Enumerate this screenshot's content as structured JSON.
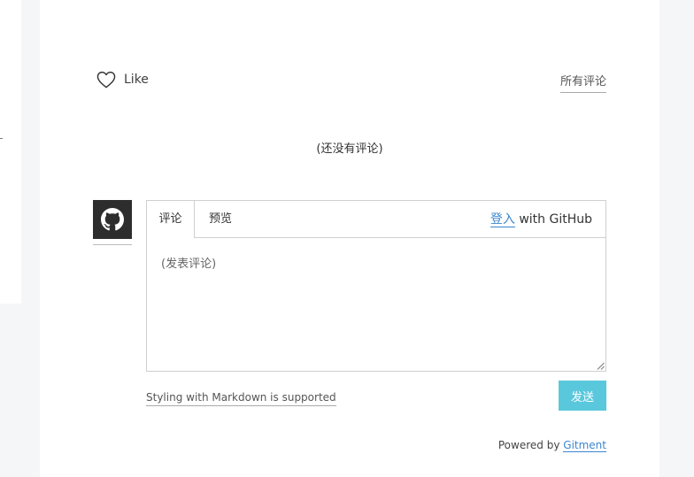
{
  "like": {
    "label": "Like",
    "icon": "heart-outline-icon"
  },
  "header": {
    "all_comments": "所有评论"
  },
  "comments": {
    "empty_text": "(还没有评论)"
  },
  "avatar": {
    "icon": "github-icon"
  },
  "editor": {
    "tabs": [
      {
        "label": "评论",
        "active": true
      },
      {
        "label": "预览",
        "active": false
      }
    ],
    "login_link": "登入",
    "login_suffix": "with GitHub",
    "textarea_placeholder": "(发表评论)"
  },
  "footer": {
    "markdown_note": "Styling with Markdown is supported",
    "send_label": "发送",
    "powered_prefix": "Powered by",
    "powered_link": "Gitment"
  },
  "colors": {
    "accent": "#5ac8dc",
    "link": "#3c86cf",
    "avatar_bg": "#2d2d2d",
    "page_bg": "#f5f6f8"
  }
}
